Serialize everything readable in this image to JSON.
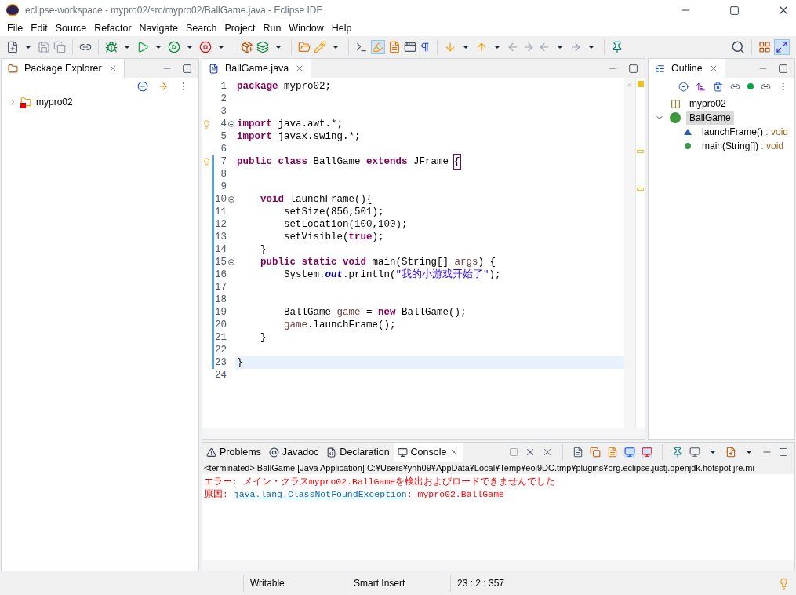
{
  "window": {
    "title": "eclipse-workspace - mypro02/src/mypro02/BallGame.java - Eclipse IDE"
  },
  "menu": [
    "File",
    "Edit",
    "Source",
    "Refactor",
    "Navigate",
    "Search",
    "Project",
    "Run",
    "Window",
    "Help"
  ],
  "package_explorer": {
    "title": "Package Explorer",
    "items": [
      {
        "label": "mypro02",
        "expanded": false,
        "error": true
      }
    ]
  },
  "editor": {
    "tab": {
      "label": "BallGame.java",
      "selected": true
    },
    "lines": [
      {
        "no": "1",
        "changed": false,
        "selected": false,
        "tokens": [
          {
            "kind": "k",
            "text": "package"
          },
          {
            "kind": "t",
            "text": " mypro02;"
          }
        ]
      },
      {
        "no": "2",
        "changed": false,
        "selected": false
      },
      {
        "no": "3",
        "changed": false,
        "selected": false
      },
      {
        "no": "4",
        "warning": true,
        "fold": true,
        "changed": false,
        "selected": false,
        "tokens": [
          {
            "kind": "k",
            "text": "import"
          },
          {
            "kind": "t",
            "text": " java.awt.*;"
          }
        ]
      },
      {
        "no": "5",
        "changed": false,
        "selected": false,
        "tokens": [
          {
            "kind": "k",
            "text": "import"
          },
          {
            "kind": "t",
            "text": " javax.swing.*;"
          }
        ]
      },
      {
        "no": "6",
        "changed": false,
        "selected": false
      },
      {
        "no": "7",
        "warning": true,
        "changed": true,
        "selected": false,
        "tokens": [
          {
            "kind": "k",
            "text": "public"
          },
          {
            "kind": "k",
            "text": " class"
          },
          {
            "kind": "t",
            "text": " BallGame"
          },
          {
            "kind": "k",
            "text": " extends"
          },
          {
            "kind": "t",
            "text": " JFrame"
          },
          {
            "kind": "b",
            "text": "{"
          }
        ]
      },
      {
        "no": "8",
        "changed": true,
        "selected": false
      },
      {
        "no": "9",
        "changed": true,
        "selected": false
      },
      {
        "no": "10",
        "changed": true,
        "fold": true,
        "selected": false,
        "tokens": [
          {
            "kind": "k",
            "text": "    void"
          },
          {
            "kind": "t",
            "text": " launchFrame(){"
          }
        ]
      },
      {
        "no": "11",
        "changed": true,
        "selected": false,
        "tokens": [
          {
            "kind": "t",
            "text": "        setSize(856,501);"
          }
        ]
      },
      {
        "no": "12",
        "changed": true,
        "selected": false,
        "tokens": [
          {
            "kind": "t",
            "text": "        setLocation(100,100);"
          }
        ]
      },
      {
        "no": "13",
        "changed": true,
        "selected": false,
        "tokens": [
          {
            "kind": "t",
            "text": "        setVisible("
          },
          {
            "kind": "k",
            "text": "true"
          },
          {
            "kind": "t",
            "text": ");"
          }
        ]
      },
      {
        "no": "14",
        "changed": true,
        "selected": false,
        "tokens": [
          {
            "kind": "t",
            "text": "    }"
          }
        ]
      },
      {
        "no": "15",
        "changed": true,
        "fold": true,
        "selected": false,
        "tokens": [
          {
            "kind": "k",
            "text": "    public"
          },
          {
            "kind": "k",
            "text": " static"
          },
          {
            "kind": "k",
            "text": " void"
          },
          {
            "kind": "t",
            "text": " main(String[]"
          },
          {
            "kind": "v",
            "text": " args"
          },
          {
            "kind": "t",
            "text": ") {"
          }
        ]
      },
      {
        "no": "16",
        "changed": true,
        "selected": false,
        "tokens": [
          {
            "kind": "t",
            "text": "        System."
          },
          {
            "kind": "f",
            "text": "out"
          },
          {
            "kind": "t",
            "text": ".println("
          },
          {
            "kind": "s",
            "text": "\"我的小游戏开始了\""
          },
          {
            "kind": "t",
            "text": ");"
          }
        ]
      },
      {
        "no": "17",
        "changed": true,
        "selected": false
      },
      {
        "no": "18",
        "changed": true,
        "selected": false
      },
      {
        "no": "19",
        "changed": true,
        "selected": false,
        "tokens": [
          {
            "kind": "t",
            "text": "        BallGame"
          },
          {
            "kind": "v",
            "text": " game"
          },
          {
            "kind": "t",
            "text": " ="
          },
          {
            "kind": "k",
            "text": " new"
          },
          {
            "kind": "t",
            "text": " BallGame();"
          }
        ]
      },
      {
        "no": "20",
        "changed": true,
        "selected": false,
        "tokens": [
          {
            "kind": "v",
            "text": "        game"
          },
          {
            "kind": "t",
            "text": ".launchFrame();"
          }
        ]
      },
      {
        "no": "21",
        "changed": true,
        "selected": false,
        "tokens": [
          {
            "kind": "t",
            "text": "    }"
          }
        ]
      },
      {
        "no": "22",
        "changed": true,
        "selected": false
      },
      {
        "no": "23",
        "changed": true,
        "selected": true,
        "tokens": [
          {
            "kind": "t",
            "text": "}"
          }
        ]
      },
      {
        "no": "24",
        "changed": false,
        "selected": false
      }
    ]
  },
  "outline": {
    "title": "Outline",
    "items": [
      {
        "kind": "package",
        "label": "mypro02",
        "selected": false
      },
      {
        "kind": "class",
        "label": "BallGame",
        "selected": true,
        "expanded": true,
        "children": [
          {
            "kind": "method",
            "label": "launchFrame()",
            "type": " : void",
            "selected": false
          },
          {
            "kind": "static_method",
            "label": "main(String[])",
            "type": " : void",
            "selected": false
          }
        ]
      }
    ]
  },
  "bottom_tabs": [
    {
      "label": "Problems",
      "selected": false
    },
    {
      "label": "Javadoc",
      "selected": false
    },
    {
      "label": "Declaration",
      "selected": false
    },
    {
      "label": "Console",
      "selected": true
    }
  ],
  "console": {
    "header": "<terminated> BallGame [Java Application] C:¥Users¥yhh09¥AppData¥Local¥Temp¥eoi9DC.tmp¥plugins¥org.eclipse.justj.openjdk.hotspot.jre.mi",
    "lines": [
      [
        {
          "kind": "err",
          "text": "エラー: メイン・クラスmypro02.BallGameを検出およびロードできませんでした"
        }
      ],
      [
        {
          "kind": "err",
          "text": "原因:"
        },
        {
          "kind": "link",
          "text": "java.lang.ClassNotFoundException"
        },
        {
          "kind": "err",
          "text": ": mypro02.BallGame"
        }
      ]
    ]
  },
  "status_bar": [
    "Writable",
    "Smart Insert",
    "23 : 2 : 357"
  ]
}
